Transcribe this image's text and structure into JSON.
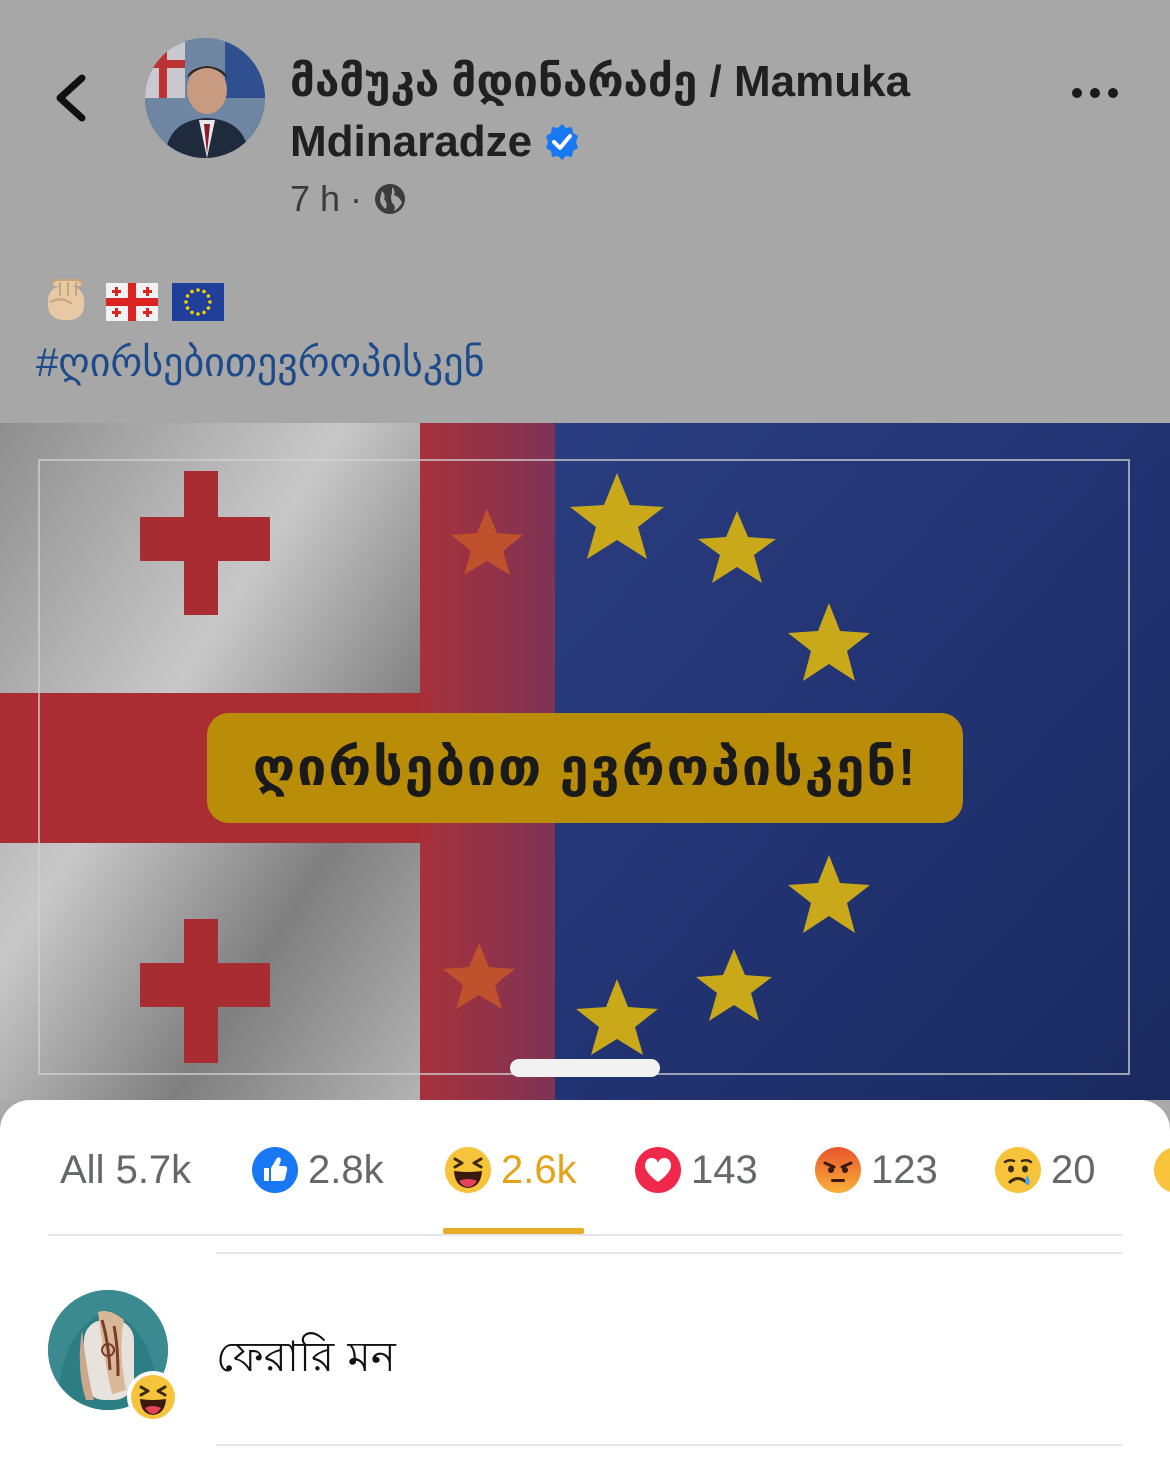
{
  "post": {
    "author_name": "მამუკა მდინარაძე / Mamuka Mdinaradze",
    "time": "7 h",
    "dot": "·",
    "emojis": [
      "fist-emoji",
      "georgia-flag-emoji",
      "eu-flag-emoji"
    ],
    "hashtag": "#ღირსებითევროპისკენ",
    "image_banner": "ღირსებით ევროპისკენ!"
  },
  "reactions": {
    "tabs": [
      {
        "label": "All 5.7k",
        "icon": null
      },
      {
        "label": "2.8k",
        "icon": "like-icon"
      },
      {
        "label": "2.6k",
        "icon": "haha-icon",
        "active": true
      },
      {
        "label": "143",
        "icon": "love-icon"
      },
      {
        "label": "123",
        "icon": "angry-icon"
      },
      {
        "label": "20",
        "icon": "sad-icon"
      }
    ],
    "people": [
      {
        "name": "ফেরারি মন",
        "reaction": "haha-icon"
      }
    ]
  },
  "colors": {
    "accent_active": "#e4a41a",
    "hashtag": "#1d4a8a",
    "verified": "#1877f2",
    "banner": "#b98d07"
  }
}
